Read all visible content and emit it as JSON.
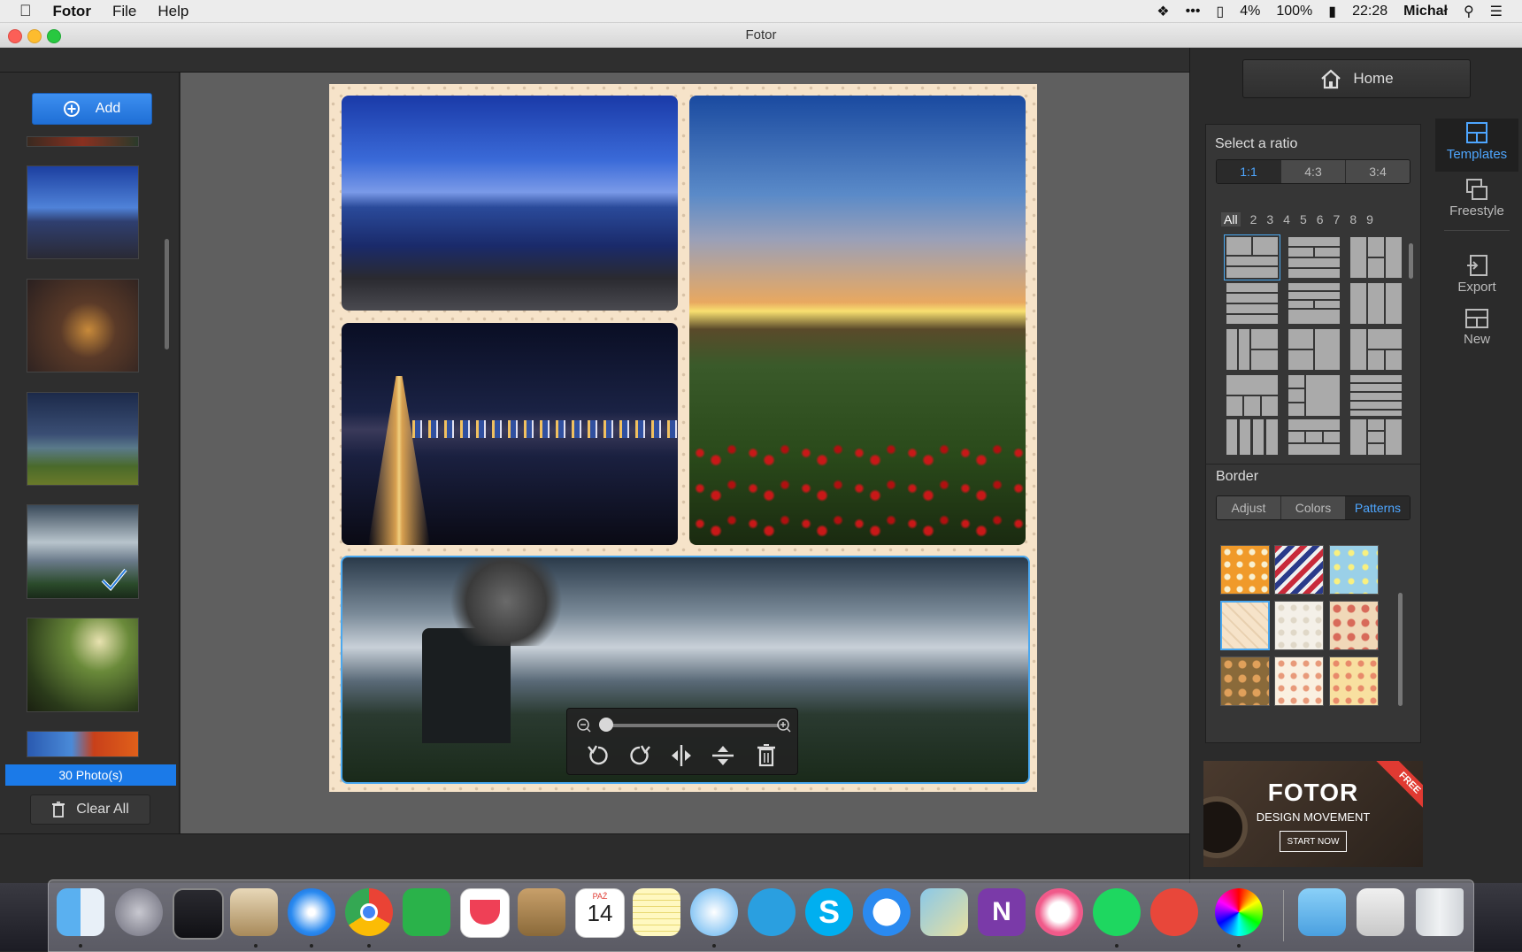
{
  "menubar": {
    "app_name": "Fotor",
    "items": [
      "File",
      "Help"
    ],
    "status": {
      "battery_small": "4%",
      "battery": "100%",
      "time": "22:28",
      "user": "Michał"
    }
  },
  "window": {
    "title": "Fotor"
  },
  "left_panel": {
    "add_label": "Add",
    "photo_count": "30 Photo(s)",
    "clear_label": "Clear All"
  },
  "right_panel": {
    "home_label": "Home",
    "ratio_heading": "Select a ratio",
    "ratios": [
      "1:1",
      "4:3",
      "3:4"
    ],
    "selected_ratio": "1:1",
    "counts": [
      "All",
      "2",
      "3",
      "4",
      "5",
      "6",
      "7",
      "8",
      "9"
    ],
    "border_heading": "Border",
    "border_tabs": [
      "Adjust",
      "Colors",
      "Patterns"
    ],
    "selected_border_tab": "Patterns",
    "nav": [
      {
        "label": "Templates",
        "icon": "templates-icon",
        "selected": true
      },
      {
        "label": "Freestyle",
        "icon": "freestyle-icon",
        "selected": false
      },
      {
        "label": "Export",
        "icon": "export-icon",
        "selected": false
      },
      {
        "label": "New",
        "icon": "new-icon",
        "selected": false
      }
    ]
  },
  "ad": {
    "title": "FOTOR",
    "subtitle": "DESIGN MOVEMENT",
    "button": "START NOW",
    "ribbon": "FREE"
  },
  "dock": {
    "calendar_month": "PAŹ",
    "calendar_day": "14"
  },
  "colors": {
    "accent": "#1b7ae8",
    "selected_text": "#4ea6ff"
  }
}
